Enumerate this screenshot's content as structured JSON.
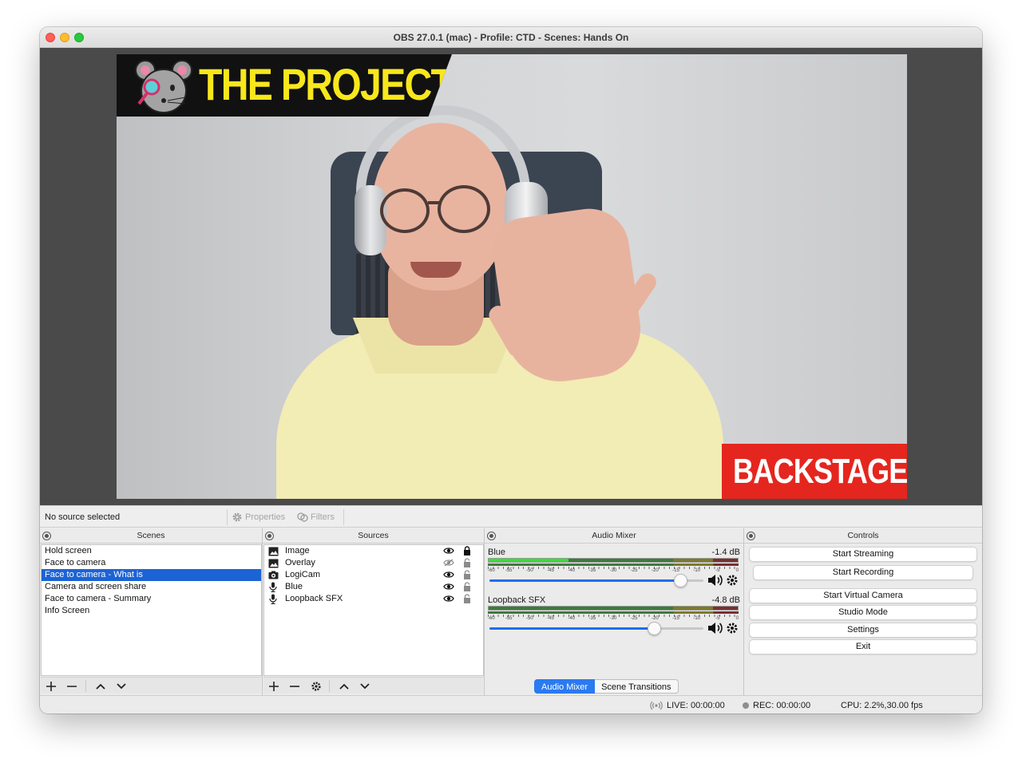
{
  "window": {
    "title": "OBS 27.0.1 (mac) - Profile: CTD - Scenes: Hands On"
  },
  "preview": {
    "banner_text": "THE PROJECT",
    "brand_text": "BACKSTAGE.IO",
    "colors": {
      "banner_bg": "#111111",
      "banner_text": "#f8e71c",
      "brand_bg": "#e4261f",
      "brand_text": "#ffffff"
    }
  },
  "source_bar": {
    "status": "No source selected",
    "properties_label": "Properties",
    "filters_label": "Filters"
  },
  "scenes": {
    "title": "Scenes",
    "items": [
      {
        "label": "Hold screen",
        "selected": false
      },
      {
        "label": "Face to camera",
        "selected": false
      },
      {
        "label": "Face to camera - What is",
        "selected": true
      },
      {
        "label": "Camera and screen share",
        "selected": false
      },
      {
        "label": "Face to camera - Summary",
        "selected": false
      },
      {
        "label": "Info Screen",
        "selected": false
      }
    ]
  },
  "sources": {
    "title": "Sources",
    "items": [
      {
        "label": "Image",
        "icon": "image-icon",
        "visible": true,
        "locked": true
      },
      {
        "label": "Overlay",
        "icon": "image-icon",
        "visible": false,
        "locked": false
      },
      {
        "label": "LogiCam",
        "icon": "camera-icon",
        "visible": true,
        "locked": false
      },
      {
        "label": "Blue",
        "icon": "microphone-icon",
        "visible": true,
        "locked": false
      },
      {
        "label": "Loopback SFX",
        "icon": "microphone-icon",
        "visible": true,
        "locked": false
      }
    ]
  },
  "audio_mixer": {
    "title": "Audio Mixer",
    "scale": [
      "-60",
      "-55",
      "-50",
      "-45",
      "-40",
      "-35",
      "-30",
      "-25",
      "-20",
      "-15",
      "-10",
      "-5",
      "0"
    ],
    "channels": [
      {
        "name": "Blue",
        "db": "-1.4 dB",
        "level": 0.32,
        "volume": 0.89
      },
      {
        "name": "Loopback SFX",
        "db": "-4.8 dB",
        "level": 0.0,
        "volume": 0.77
      }
    ],
    "tabs": [
      "Audio Mixer",
      "Scene Transitions"
    ]
  },
  "controls": {
    "title": "Controls",
    "buttons": [
      "Start Streaming",
      "Start Recording",
      "Start Virtual Camera",
      "Studio Mode",
      "Settings",
      "Exit"
    ]
  },
  "status": {
    "live": "LIVE: 00:00:00",
    "rec": "REC: 00:00:00",
    "cpu": "CPU: 2.2%,30.00 fps"
  }
}
